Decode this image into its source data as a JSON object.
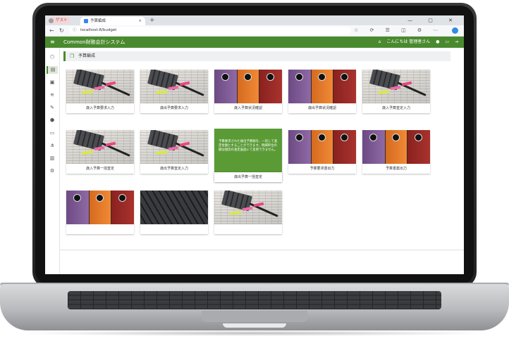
{
  "browser": {
    "profile_label": "ゲスト",
    "tab_title": "予算編成",
    "tab_close": "×",
    "new_tab": "+",
    "window_controls": "— ▢ ✕",
    "url": "localhost:8/budget",
    "nav_back": "←",
    "nav_refresh": "↻"
  },
  "app": {
    "menu_glyph": "≡",
    "title": "Common財務会計システム",
    "greeting": "こんにちは 管理者さん"
  },
  "breadcrumb": {
    "title": "予算編成"
  },
  "cards": [
    {
      "label": "歳入予算要求入力",
      "image": "calculator"
    },
    {
      "label": "歳出予算要求入力",
      "image": "calculator"
    },
    {
      "label": "歳入予算状況確認",
      "image": "binders"
    },
    {
      "label": "歳出予算状況確認",
      "image": "binders"
    },
    {
      "label": "歳入予算査定入力",
      "image": "calculator"
    },
    {
      "label": "歳入予算一括査定",
      "image": "calculator"
    },
    {
      "label": "歳出予算査定入力",
      "image": "calculator"
    },
    {
      "label": "歳出予算一括査定",
      "image": "highlighted",
      "description": "予算要求された歳出予算額を、一括して査定金額とすることができます。明細単位の額は個別の査定画面にて変更できません。"
    },
    {
      "label": "予算要求書出力",
      "image": "binders"
    },
    {
      "label": "予算書案出力",
      "image": "binders"
    },
    {
      "label": "",
      "image": "binders"
    },
    {
      "label": "",
      "image": "keyboard"
    },
    {
      "label": "",
      "image": "calculator"
    }
  ],
  "colors": {
    "brand_green": "#4a8a2e",
    "hover_green": "#5a9b36"
  }
}
